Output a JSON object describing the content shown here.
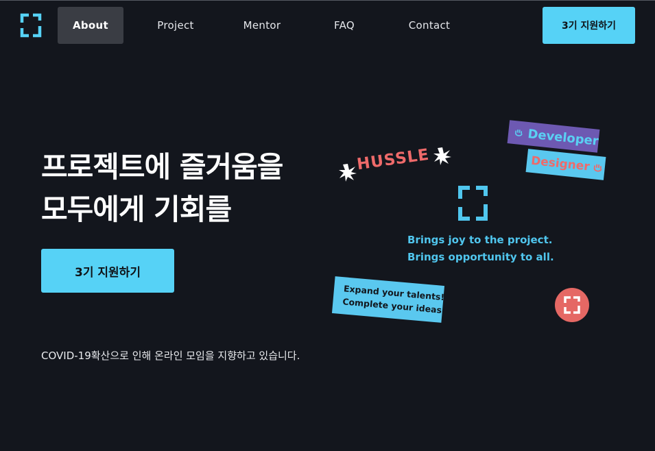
{
  "header": {
    "nav": [
      {
        "label": "About",
        "active": true
      },
      {
        "label": "Project",
        "active": false
      },
      {
        "label": "Mentor",
        "active": false
      },
      {
        "label": "FAQ",
        "active": false
      },
      {
        "label": "Contact",
        "active": false
      }
    ],
    "apply_label": "3기 지원하기",
    "logo_icon": "bracket-logo-icon"
  },
  "hero": {
    "title_line1": "프로젝트에 즐거움을",
    "title_line2": "모두에게 기회를",
    "apply_label": "3기 지원하기",
    "notice": "COVID-19확산으로 인해 온라인 모임을 지향하고 있습니다."
  },
  "stickers": {
    "hussle": "HUSSLE",
    "developer": "Developer",
    "designer": "Designer",
    "bring_line1": "Brings joy to the project.",
    "bring_line2": "Brings opportunity to all.",
    "expand_line1": "Expand your talents!",
    "expand_line2": "Complete your ideas!"
  },
  "colors": {
    "background": "#13161d",
    "accent": "#56d2f6",
    "coral": "#ee6a6a",
    "purple": "#6d59b2",
    "nav_active": "#3a3d44"
  }
}
